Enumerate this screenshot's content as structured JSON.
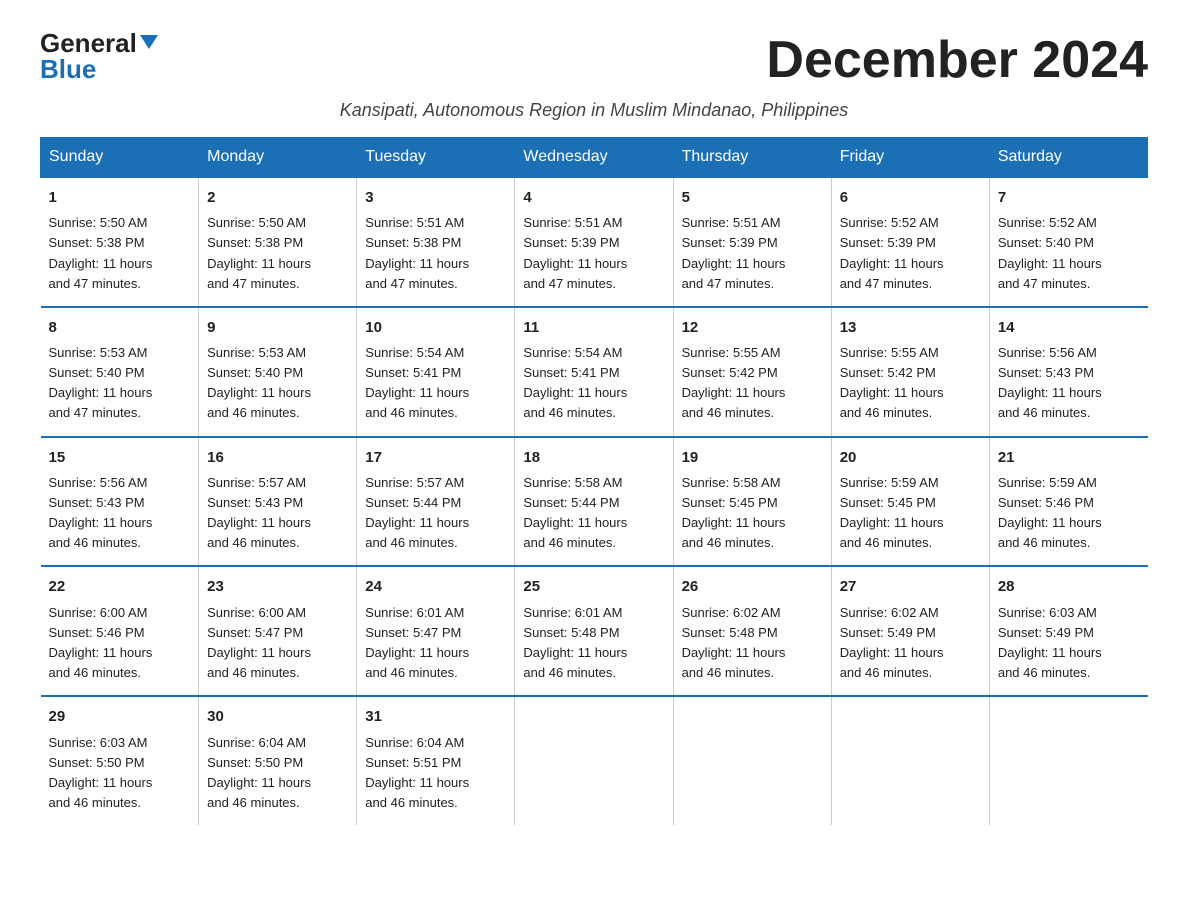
{
  "logo": {
    "general": "General",
    "blue": "Blue"
  },
  "title": "December 2024",
  "subtitle": "Kansipati, Autonomous Region in Muslim Mindanao, Philippines",
  "days_of_week": [
    "Sunday",
    "Monday",
    "Tuesday",
    "Wednesday",
    "Thursday",
    "Friday",
    "Saturday"
  ],
  "weeks": [
    [
      {
        "day": "1",
        "info": "Sunrise: 5:50 AM\nSunset: 5:38 PM\nDaylight: 11 hours\nand 47 minutes."
      },
      {
        "day": "2",
        "info": "Sunrise: 5:50 AM\nSunset: 5:38 PM\nDaylight: 11 hours\nand 47 minutes."
      },
      {
        "day": "3",
        "info": "Sunrise: 5:51 AM\nSunset: 5:38 PM\nDaylight: 11 hours\nand 47 minutes."
      },
      {
        "day": "4",
        "info": "Sunrise: 5:51 AM\nSunset: 5:39 PM\nDaylight: 11 hours\nand 47 minutes."
      },
      {
        "day": "5",
        "info": "Sunrise: 5:51 AM\nSunset: 5:39 PM\nDaylight: 11 hours\nand 47 minutes."
      },
      {
        "day": "6",
        "info": "Sunrise: 5:52 AM\nSunset: 5:39 PM\nDaylight: 11 hours\nand 47 minutes."
      },
      {
        "day": "7",
        "info": "Sunrise: 5:52 AM\nSunset: 5:40 PM\nDaylight: 11 hours\nand 47 minutes."
      }
    ],
    [
      {
        "day": "8",
        "info": "Sunrise: 5:53 AM\nSunset: 5:40 PM\nDaylight: 11 hours\nand 47 minutes."
      },
      {
        "day": "9",
        "info": "Sunrise: 5:53 AM\nSunset: 5:40 PM\nDaylight: 11 hours\nand 46 minutes."
      },
      {
        "day": "10",
        "info": "Sunrise: 5:54 AM\nSunset: 5:41 PM\nDaylight: 11 hours\nand 46 minutes."
      },
      {
        "day": "11",
        "info": "Sunrise: 5:54 AM\nSunset: 5:41 PM\nDaylight: 11 hours\nand 46 minutes."
      },
      {
        "day": "12",
        "info": "Sunrise: 5:55 AM\nSunset: 5:42 PM\nDaylight: 11 hours\nand 46 minutes."
      },
      {
        "day": "13",
        "info": "Sunrise: 5:55 AM\nSunset: 5:42 PM\nDaylight: 11 hours\nand 46 minutes."
      },
      {
        "day": "14",
        "info": "Sunrise: 5:56 AM\nSunset: 5:43 PM\nDaylight: 11 hours\nand 46 minutes."
      }
    ],
    [
      {
        "day": "15",
        "info": "Sunrise: 5:56 AM\nSunset: 5:43 PM\nDaylight: 11 hours\nand 46 minutes."
      },
      {
        "day": "16",
        "info": "Sunrise: 5:57 AM\nSunset: 5:43 PM\nDaylight: 11 hours\nand 46 minutes."
      },
      {
        "day": "17",
        "info": "Sunrise: 5:57 AM\nSunset: 5:44 PM\nDaylight: 11 hours\nand 46 minutes."
      },
      {
        "day": "18",
        "info": "Sunrise: 5:58 AM\nSunset: 5:44 PM\nDaylight: 11 hours\nand 46 minutes."
      },
      {
        "day": "19",
        "info": "Sunrise: 5:58 AM\nSunset: 5:45 PM\nDaylight: 11 hours\nand 46 minutes."
      },
      {
        "day": "20",
        "info": "Sunrise: 5:59 AM\nSunset: 5:45 PM\nDaylight: 11 hours\nand 46 minutes."
      },
      {
        "day": "21",
        "info": "Sunrise: 5:59 AM\nSunset: 5:46 PM\nDaylight: 11 hours\nand 46 minutes."
      }
    ],
    [
      {
        "day": "22",
        "info": "Sunrise: 6:00 AM\nSunset: 5:46 PM\nDaylight: 11 hours\nand 46 minutes."
      },
      {
        "day": "23",
        "info": "Sunrise: 6:00 AM\nSunset: 5:47 PM\nDaylight: 11 hours\nand 46 minutes."
      },
      {
        "day": "24",
        "info": "Sunrise: 6:01 AM\nSunset: 5:47 PM\nDaylight: 11 hours\nand 46 minutes."
      },
      {
        "day": "25",
        "info": "Sunrise: 6:01 AM\nSunset: 5:48 PM\nDaylight: 11 hours\nand 46 minutes."
      },
      {
        "day": "26",
        "info": "Sunrise: 6:02 AM\nSunset: 5:48 PM\nDaylight: 11 hours\nand 46 minutes."
      },
      {
        "day": "27",
        "info": "Sunrise: 6:02 AM\nSunset: 5:49 PM\nDaylight: 11 hours\nand 46 minutes."
      },
      {
        "day": "28",
        "info": "Sunrise: 6:03 AM\nSunset: 5:49 PM\nDaylight: 11 hours\nand 46 minutes."
      }
    ],
    [
      {
        "day": "29",
        "info": "Sunrise: 6:03 AM\nSunset: 5:50 PM\nDaylight: 11 hours\nand 46 minutes."
      },
      {
        "day": "30",
        "info": "Sunrise: 6:04 AM\nSunset: 5:50 PM\nDaylight: 11 hours\nand 46 minutes."
      },
      {
        "day": "31",
        "info": "Sunrise: 6:04 AM\nSunset: 5:51 PM\nDaylight: 11 hours\nand 46 minutes."
      },
      {
        "day": "",
        "info": ""
      },
      {
        "day": "",
        "info": ""
      },
      {
        "day": "",
        "info": ""
      },
      {
        "day": "",
        "info": ""
      }
    ]
  ]
}
